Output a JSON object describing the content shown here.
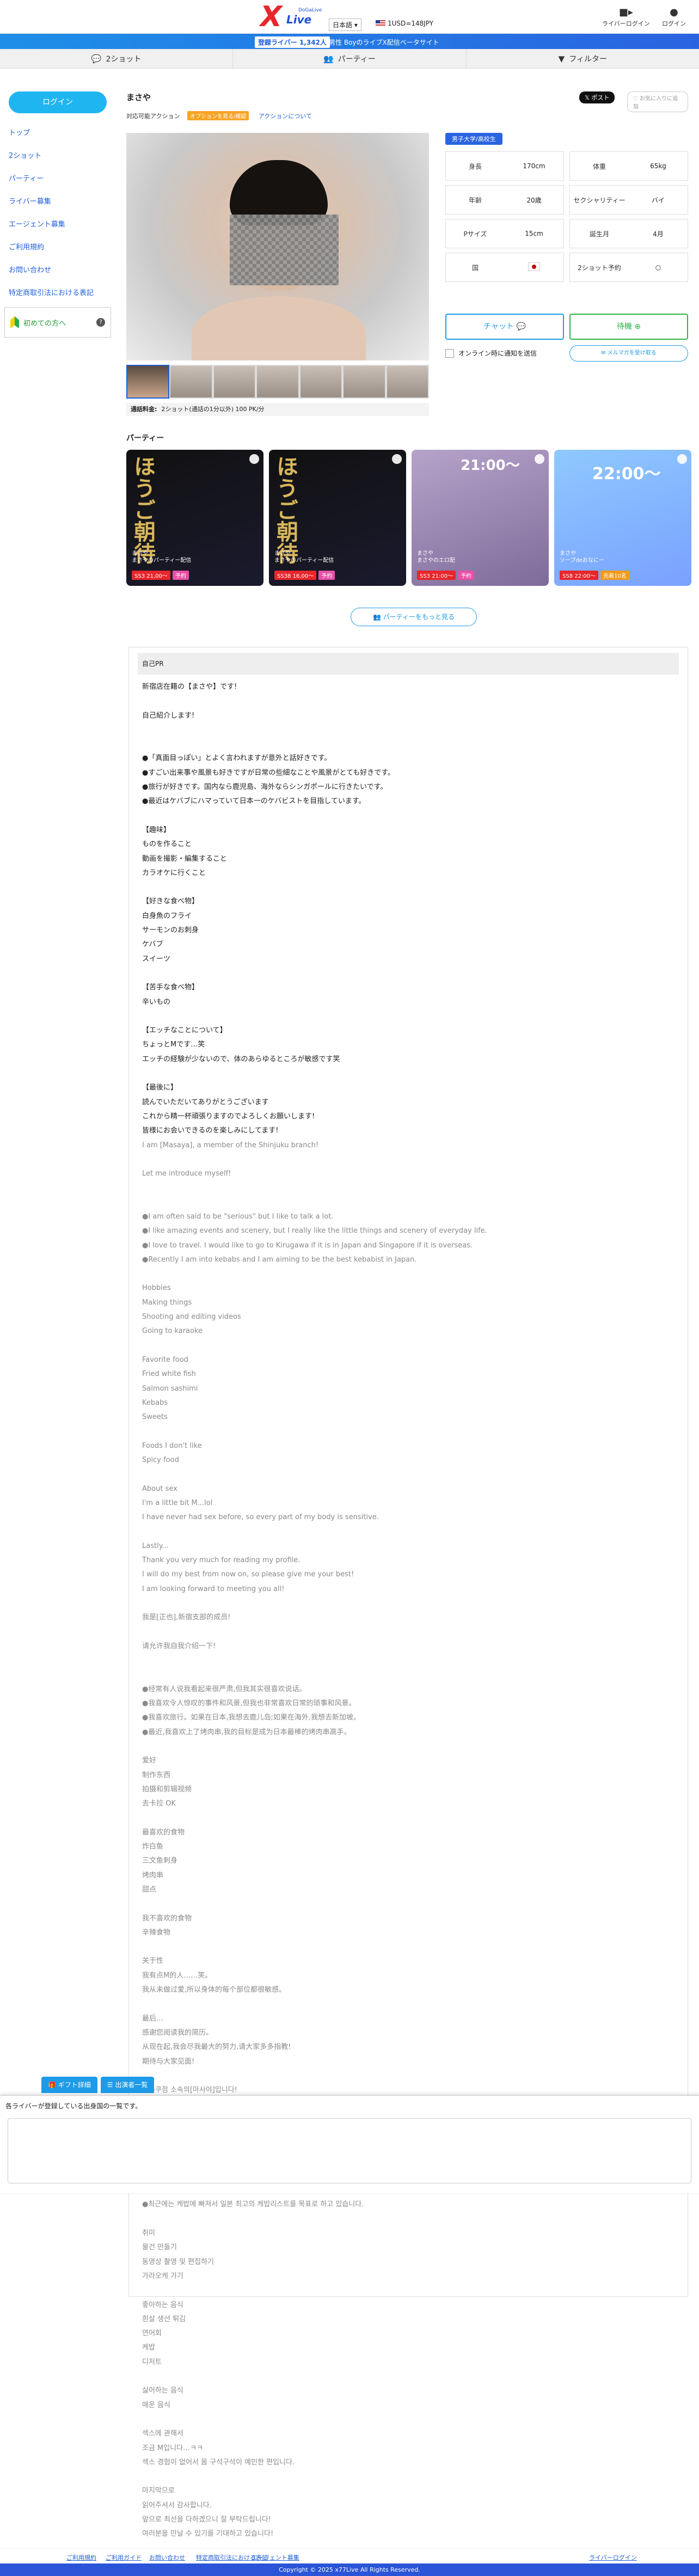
{
  "header": {
    "logo_text": "Live",
    "logo_x": "X",
    "logo_sub": "DoGaLive",
    "lang": "日本語",
    "rate": "1USD=148JPY",
    "liver_login": "ライバーログイン",
    "login": "ログイン"
  },
  "banner": {
    "badge": "登録ライバー 1,342人",
    "text": "男性 BoyのライブX配信ベータサイト"
  },
  "tabs": [
    {
      "label": "2ショット",
      "icon": "chat-icon"
    },
    {
      "label": "パーティー",
      "icon": "group-icon"
    },
    {
      "label": "フィルター",
      "icon": "filter-icon"
    }
  ],
  "sidebar": {
    "login_label": "ログイン",
    "items": [
      "トップ",
      "2ショット",
      "パーティー",
      "ライバー募集",
      "エージェント募集",
      "ご利用規約",
      "お問い合わせ",
      "特定商取引法における表記"
    ],
    "beginner": "初めての方へ"
  },
  "profile_head": {
    "name": "まさや",
    "actions_label": "対応可能アクション",
    "tag": "オプションを見る/確認",
    "link": "アクションについて",
    "post": "ポスト",
    "fav": "お気に入りに追加"
  },
  "price_line": {
    "label": "通話料金:",
    "value": "2ショット(通話の1分以外) 100 PK/分"
  },
  "profile": {
    "category": "男子大学/高校生",
    "cells": [
      {
        "k": "身長",
        "v": "170cm"
      },
      {
        "k": "体重",
        "v": "65kg"
      },
      {
        "k": "年齢",
        "v": "20歳"
      },
      {
        "k": "セクシャリティー",
        "v": "バイ"
      },
      {
        "k": "Pサイズ",
        "v": "15cm"
      },
      {
        "k": "誕生月",
        "v": "4月"
      },
      {
        "k": "国",
        "v": ""
      },
      {
        "k": "2ショット予約",
        "v": "○"
      }
    ],
    "chat_btn": "チャット",
    "wait_btn": "待機",
    "notify": "オンライン時に通知を送信",
    "mail_btn": "メルマガを受け取る"
  },
  "party": {
    "title": "パーティー",
    "cards": [
      {
        "bg": "ほうご朝待",
        "name": "まさや",
        "title": "まさやのパーティー配信",
        "price": "SS3 21,00〜",
        "tag": "予約",
        "colors": [
          "#111111",
          "#1a1a2e"
        ]
      },
      {
        "bg": "ほうご朝待",
        "name": "まさや",
        "title": "まさやのパーティー配信",
        "price": "SS38 16,00〜",
        "tag": "予約",
        "colors": [
          "#111111",
          "#1a1a2e"
        ]
      },
      {
        "bg": "21:00〜",
        "name": "まさや",
        "title": "まさやのエロ配",
        "price": "SS3 21:00〜",
        "tag": "予約",
        "colors": [
          "#b6a3c9",
          "#7f6b9a"
        ]
      },
      {
        "bg": "22:00〜",
        "name": "まさや",
        "title": "ソープdeおなにー",
        "price": "SS8 22:00〜",
        "tag": "先着10名",
        "colors": [
          "#8ec9ff",
          "#7aa1ff"
        ]
      }
    ],
    "more": "パーティーをもっと見る"
  },
  "self_pr": {
    "heading": "自己PR",
    "text_jp": "新宿店在籍の【まさや】です!\n\n自己紹介します!\n\n\n●「真面目っぽい」とよく言われますが意外と話好きです。\n●すごい出来事や風景も好きですが日常の些細なことや風景がとても好きです。\n●旅行が好きです。国内なら鹿児島、海外ならシンガポールに行きたいです。\n●最近はケバブにハマっていて日本一のケバビストを目指しています。\n\n【趣味】\nものを作ること\n動画を撮影・編集すること\nカラオケに行くこと\n\n【好きな食べ物】\n白身魚のフライ\nサーモンのお刺身\nケバブ\nスイーツ\n\n【苦手な食べ物】\n辛いもの\n\n【エッチなことについて】\nちょっとMです…笑\nエッチの経験が少ないので、体のあらゆるところが敏感です笑\n\n【最後に】\n読んでいただいてありがとうございます\nこれから精一杯頑張りますのでよろしくお願いします!\n皆様にお会いできるのを楽しみにしてます!",
    "text_en": "I am [Masaya], a member of the Shinjuku branch!\n\nLet me introduce myself!\n\n\n●I am often said to be \"serious\" but I like to talk a lot.\n●I like amazing events and scenery, but I really like the little things and scenery of everyday life.\n●I love to travel. I would like to go to Kirugawa if it is in Japan and Singapore if it is overseas.\n●Recently I am into kebabs and I am aiming to be the best kebabist in Japan.\n\nHobbies\nMaking things\nShooting and editing videos\nGoing to karaoke\n\nFavorite food\nFried white fish\nSalmon sashimi\nKebabs\nSweets\n\nFoods I don't like\nSpicy food\n\nAbout sex\nI'm a little bit M...lol\nI have never had sex before, so every part of my body is sensitive.\n\nLastly...\nThank you very much for reading my profile.\nI will do my best from now on, so please give me your best!\nI am looking forward to meeting you all!\n\n我是[正也],新宿支部的成员!\n\n请允许我自我介绍一下!\n\n\n●经常有人说我看起来很严肃,但我其实很喜欢说话。\n●我喜欢令人惊叹的事件和风景,但我也非常喜欢日常的琐事和风景。\n●我喜欢旅行。如果在日本,我想去鹿儿岛;如果在海外,我想去新加坡。\n●最近,我喜欢上了烤肉串,我的目标是成为日本最棒的烤肉串高手。\n\n爱好\n制作东西\n拍摄和剪辑视频\n去卡拉 OK\n\n最喜欢的食物\n炸白鱼\n三文鱼刺身\n烤肉串\n甜点\n\n我不喜欢的食物\n辛辣食物\n\n关于性\n我有点M的人……笑。\n我从未做过爱,所以身体的每个部位都很敏感。\n\n最后…\n感谢您阅读我的简历。\n从现在起,我会尽我最大的努力,请大家多多指教!\n期待与大家见面!\n\n신주쿠점 소속의[마사야]입니다!\n\n자기소개합니다!\n\n\n●\"진지해 보인다\"는 말을 자주 듣지만 의외로 이야기하는 것을 좋아합니다.\n●멋진 일이나 풍경도 좋아하지만 일상의 사소한 일이나 풍경을 아주 좋아합니다.\n●여행을 좋아합니다. 국내라면 가고시마, 해외라면 싱가포르에 가고 싶어요.\n●최근에는 케밥에 빠져서 일본 최고의 케밥리스트를 목표로 하고 있습니다.\n\n취미\n물건 만들기\n동영상 촬영 및 편집하기\n가라오케 가기\n\n좋아하는 음식\n흰살 생선 튀김\n연어회\n케밥\n디저트\n\n싫어하는 음식\n매운 음식\n\n섹스에 관해서\n조금 M입니다…ㅋㅋ\n섹스 경험이 없어서 몸 구석구석이 예민한 편입니다.\n\n마지막으로\n읽어주셔서 감사합니다.\n앞으로 최선을 다하겠으니 잘 부탁드립니다!\n여러분을 만날 수 있기를 기대하고 있습니다!"
  },
  "floating": {
    "gift": "ギフト詳細",
    "schedule": "出演者一覧",
    "panel_text": "各ライバーが登録している出身国の一覧です。"
  },
  "footer": {
    "links": [
      "ご利用規約",
      "ご利用ガイド",
      "お問い合わせ",
      "特定商取引法における表記",
      "エージェント募集",
      "ライバーログイン"
    ],
    "copyright": "Copyright © 2025 x77Live  All Rights Reserved."
  },
  "colors": {
    "accent": "#1e5fd8",
    "brand_red": "#e8262b",
    "sky": "#1fb5f0",
    "green": "#2bb44a"
  }
}
